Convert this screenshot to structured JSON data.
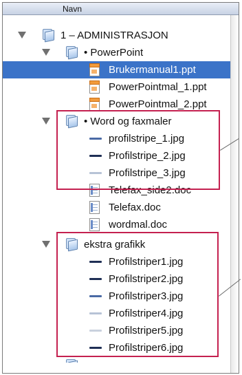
{
  "header": {
    "column_label": "Navn"
  },
  "tree": {
    "root": {
      "label": "1 – ADMINISTRASJON"
    },
    "powerpoint_folder": {
      "label": "• PowerPoint"
    },
    "brukermanual": {
      "label": "Brukermanual1.ppt"
    },
    "ppt_mal1": {
      "label": "PowerPointmal_1.ppt"
    },
    "ppt_mal2": {
      "label": "PowerPointmal_2.ppt"
    },
    "word_folder": {
      "label": "• Word og faxmaler"
    },
    "profilstripe1": {
      "label": "profilstripe_1.jpg"
    },
    "profilstripe2": {
      "label": "Profilstripe_2.jpg"
    },
    "profilstripe3": {
      "label": "Profilstripe_3.jpg"
    },
    "telefax_side2": {
      "label": "Telefax_side2.doc"
    },
    "telefax": {
      "label": "Telefax.doc"
    },
    "wordmal": {
      "label": "wordmal.doc"
    },
    "ekstra_folder": {
      "label": "ekstra grafikk"
    },
    "profilstriper1": {
      "label": "Profilstriper1.jpg"
    },
    "profilstriper2": {
      "label": "Profilstriper2.jpg"
    },
    "profilstriper3": {
      "label": "Profilstriper3.jpg"
    },
    "profilstriper4": {
      "label": "Profilstriper4.jpg"
    },
    "profilstriper5": {
      "label": "Profilstriper5.jpg"
    },
    "profilstriper6": {
      "label": "Profilstriper6.jpg"
    }
  },
  "colors": {
    "selection": "#3b73c8",
    "highlight_box": "#c4204f",
    "stripe_dark": "#1f2f55",
    "stripe_medium": "#4a6aa5",
    "stripe_light": "#b7c3d6"
  }
}
